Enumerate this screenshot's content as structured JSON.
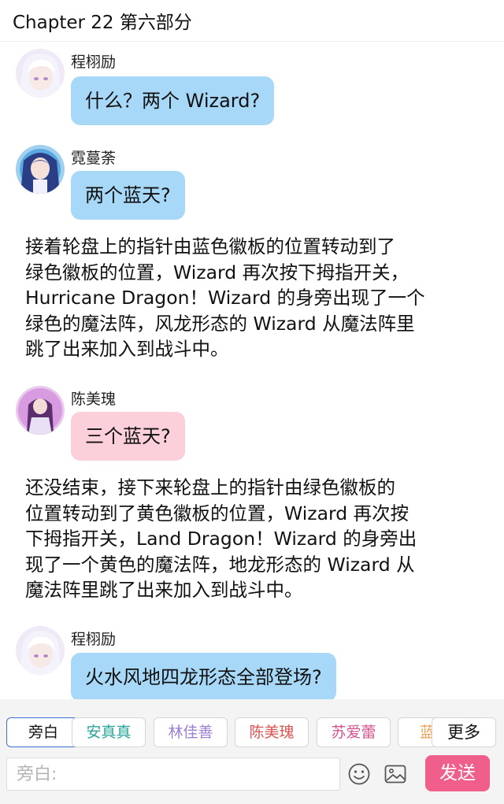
{
  "header": {
    "title": "Chapter 22 第六部分"
  },
  "messages": [
    {
      "speaker": "程栩励",
      "text": "什么？两个 Wizard?"
    },
    {
      "speaker": "霓蔓荼",
      "text": "两个蓝天?"
    },
    {
      "narration": [
        "接着轮盘上的指针由蓝色徽板的位置转动到了",
        "绿色徽板的位置，Wizard 再次按下拇指开关，",
        "Hurricane Dragon！Wizard 的身旁出现了一个",
        "绿色的魔法阵，风龙形态的 Wizard 从魔法阵里",
        "跳了出来加入到战斗中。"
      ]
    },
    {
      "speaker": "陈美瑰",
      "text": "三个蓝天?"
    },
    {
      "narration": [
        "还没结束，接下来轮盘上的指针由绿色徽板的",
        "位置转动到了黄色徽板的位置，Wizard 再次按",
        "下拇指开关，Land Dragon！Wizard 的身旁出",
        "现了一个黄色的魔法阵，地龙形态的 Wizard 从",
        "魔法阵里跳了出来加入到战斗中。"
      ]
    },
    {
      "speaker": "程栩励",
      "text": "火水风地四龙形态全部登场?"
    }
  ],
  "toolbar": {
    "chips": [
      {
        "label": "旁白",
        "color": "#111111"
      },
      {
        "label": "安真真",
        "color": "#2aa59a"
      },
      {
        "label": "林佳善",
        "color": "#9b7fd1"
      },
      {
        "label": "陈美瑰",
        "color": "#d9534f"
      },
      {
        "label": "苏爱蕾",
        "color": "#d6548f"
      },
      {
        "label": "蓝天",
        "color": "#f0a050"
      }
    ],
    "more_label": "更多",
    "input_placeholder": "旁白:",
    "send_label": "发送",
    "emoji_icon": "emoji-icon",
    "image_icon": "image-icon"
  },
  "colors": {
    "bubble_blue": "#a8d8f8",
    "bubble_pink": "#fbd0da",
    "send_button": "#f05f8c"
  }
}
